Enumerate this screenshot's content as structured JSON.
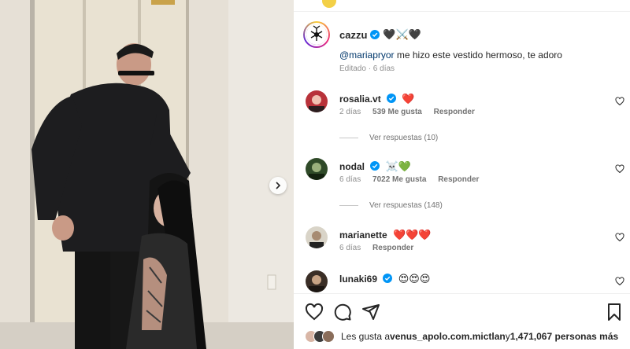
{
  "post": {
    "author": "cazzu",
    "author_emojis": "🖤⚔️🖤",
    "caption_mention": "@mariapryor",
    "caption_text": " me hizo este vestido hermoso, te adoro",
    "edited_label": "Editado · 6 días"
  },
  "comments": [
    {
      "user": "rosalia.vt",
      "emoji": "❤️",
      "age": "2 días",
      "likes": "539 Me gusta",
      "reply": "Responder",
      "view_replies": "Ver respuestas (10)"
    },
    {
      "user": "nodal",
      "emoji": "☠️💚",
      "age": "6 días",
      "likes": "7022 Me gusta",
      "reply": "Responder",
      "view_replies": "Ver respuestas (148)"
    },
    {
      "user": "marianette",
      "emoji": "❤️❤️❤️",
      "age": "6 días",
      "likes": "",
      "reply": "Responder",
      "view_replies": ""
    },
    {
      "user": "lunaki69",
      "emoji": "😍😍😍",
      "age": "",
      "likes": "",
      "reply": "",
      "view_replies": ""
    }
  ],
  "likes_summary": {
    "prefix": "Les gusta a ",
    "user": "venus_apolo.com.mictlan",
    "middle": " y ",
    "count": "1,471,067 personas más"
  },
  "icons": [
    "heart-icon",
    "comment-icon",
    "share-icon",
    "bookmark-icon",
    "verified-icon",
    "chevron-right-icon"
  ],
  "colors": {
    "verified": "#0095f6",
    "mention": "#00376b",
    "meta": "#8e8e8e"
  }
}
